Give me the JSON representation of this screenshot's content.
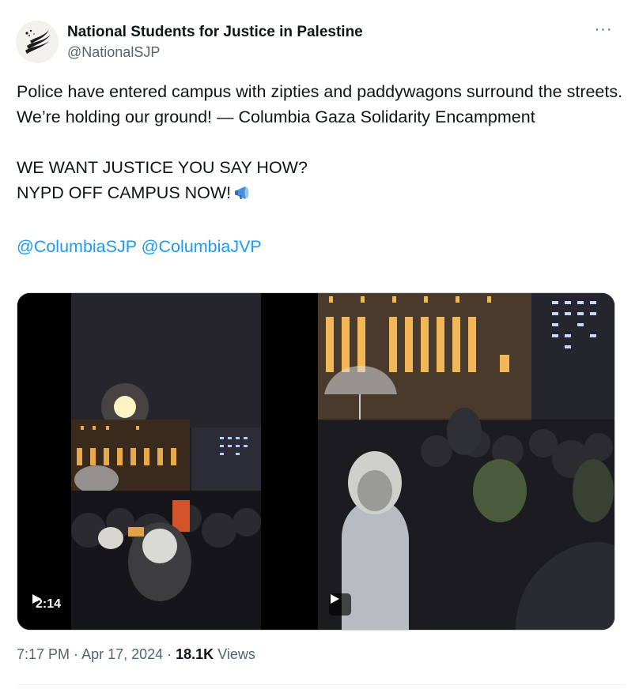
{
  "author": {
    "name": "National Students for Justice in Palestine",
    "handle": "@NationalSJP",
    "avatar_icon": "nsjp-logo-icon"
  },
  "more_label": "···",
  "tweet": {
    "line1": "Police have entered campus with zipties and paddywagons surround the streets. We’re holding our ground! — Columbia Gaza Solidarity Encampment",
    "line2": "WE WANT JUSTICE YOU SAY HOW?",
    "line3": "NYPD OFF CAMPUS NOW!",
    "emoji_icon": "megaphone-icon",
    "mention1": "@ColumbiaSJP",
    "mention2": "@ColumbiaJVP"
  },
  "media": {
    "video1_duration": "2:14",
    "video1_icon": "play-icon",
    "video2_icon": "play-icon"
  },
  "meta": {
    "time": "7:17 PM",
    "sep1": " · ",
    "date": "Apr 17, 2024",
    "sep2": " · ",
    "views_count": "18.1K",
    "views_label": " Views"
  },
  "colors": {
    "link": "#1d9bf0",
    "text": "#0f1419",
    "secondary": "#536471"
  }
}
